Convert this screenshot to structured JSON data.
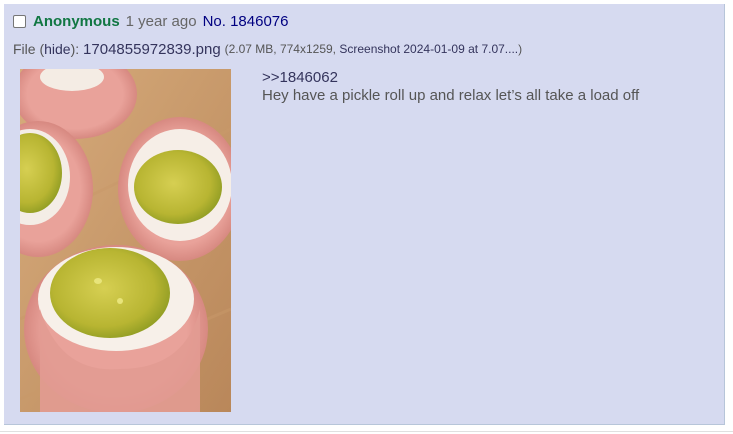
{
  "post": {
    "name": "Anonymous",
    "date": "1 year ago",
    "number_prefix": "No.",
    "number": "1846076"
  },
  "file": {
    "label": "File",
    "open_paren": "(",
    "hide_label": "hide",
    "close_paren_colon": "):",
    "filename": "1704855972839.png",
    "meta_prefix": "(2.07 MB, 774x1259, ",
    "original_name": "Screenshot 2024-01-09 at 7.07....",
    "meta_suffix": ")"
  },
  "message": {
    "quote_link": ">>1846062",
    "text": "Hey have a pickle roll up and relax let’s all take a load off"
  },
  "colors": {
    "post_background": "#d6daf0",
    "name": "#117743",
    "link": "#34345c",
    "text": "#555555"
  }
}
